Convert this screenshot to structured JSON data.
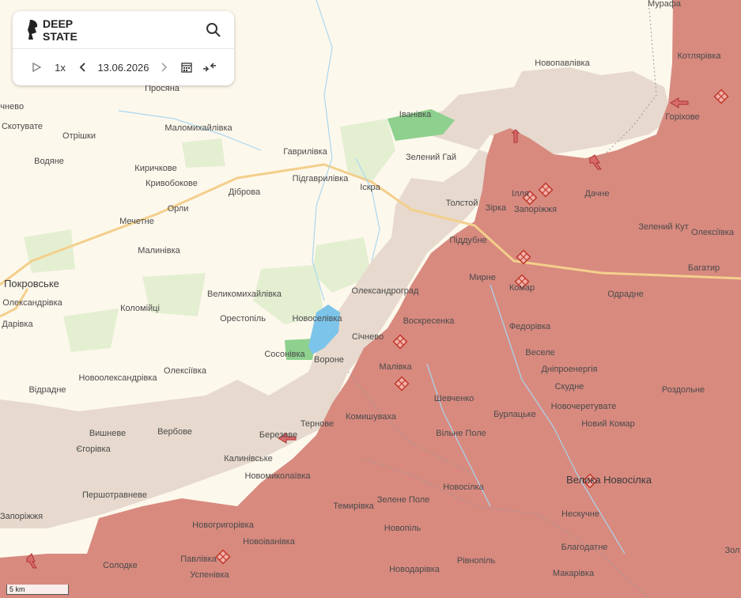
{
  "brand": {
    "line1": "DEEP",
    "line2": "STATE"
  },
  "controls": {
    "speed": "1x",
    "date": "13.06.2026"
  },
  "scale_label": "5 km",
  "colors": {
    "occupied": "#d88a7f",
    "contested": "#e6d8cc",
    "water": "#7cc4ea",
    "forest": "#8ed08e",
    "road": "#f7d99a",
    "background": "#fdf8ec"
  },
  "icons": [
    "logo-icon",
    "search-icon",
    "play-icon",
    "prev-icon",
    "next-icon",
    "calendar-icon",
    "collapse-icon",
    "battle-icon",
    "arrow-icon"
  ],
  "places": [
    {
      "name": "Просяна"
    },
    {
      "name": "Мурафа"
    },
    {
      "name": "Новопавлівка"
    },
    {
      "name": "Котлярівка"
    },
    {
      "name": "Горіхове"
    },
    {
      "name": "Маломихайлівка"
    },
    {
      "name": "Іванівка"
    },
    {
      "name": "Зелений Гай"
    },
    {
      "name": "Отрішки"
    },
    {
      "name": "Скотувате"
    },
    {
      "name": "Водяне"
    },
    {
      "name": "Гаврилівка"
    },
    {
      "name": "Киричкове"
    },
    {
      "name": "Кривобокове"
    },
    {
      "name": "Підгаврилівка"
    },
    {
      "name": "Діброва"
    },
    {
      "name": "Іскра"
    },
    {
      "name": "Орли"
    },
    {
      "name": "Мечетне"
    },
    {
      "name": "Толстой"
    },
    {
      "name": "Зірка"
    },
    {
      "name": "Запоріжжя"
    },
    {
      "name": "Дачне"
    },
    {
      "name": "Зелений Кут"
    },
    {
      "name": "Олексіївка"
    },
    {
      "name": "Малинівка"
    },
    {
      "name": "Піддубне"
    },
    {
      "name": "Покровське"
    },
    {
      "name": "Олександрівка"
    },
    {
      "name": "Мирне"
    },
    {
      "name": "Багатир"
    },
    {
      "name": "Коломійці"
    },
    {
      "name": "Великомихайлівка"
    },
    {
      "name": "Олександроград"
    },
    {
      "name": "Комар"
    },
    {
      "name": "Одрадне"
    },
    {
      "name": "Орестопіль"
    },
    {
      "name": "Новоселівка"
    },
    {
      "name": "Воскресенка"
    },
    {
      "name": "Федорівка"
    },
    {
      "name": "Січнево"
    },
    {
      "name": "Дарівка"
    },
    {
      "name": "Січнево"
    },
    {
      "name": "Сосонівка"
    },
    {
      "name": "Вороне"
    },
    {
      "name": "Веселе"
    },
    {
      "name": "Дніпроенергія"
    },
    {
      "name": "Малівка"
    },
    {
      "name": "Скудне"
    },
    {
      "name": "Новоолександрівка"
    },
    {
      "name": "Олексіївка"
    },
    {
      "name": "Роздольне"
    },
    {
      "name": "Відрадне"
    },
    {
      "name": "Шевченко"
    },
    {
      "name": "Бурлацьке"
    },
    {
      "name": "Новочеретувате"
    },
    {
      "name": "Комишуваха"
    },
    {
      "name": "Тернове"
    },
    {
      "name": "Вишневе"
    },
    {
      "name": "Вербове"
    },
    {
      "name": "Березове"
    },
    {
      "name": "Вільне Поле"
    },
    {
      "name": "Новий Комар"
    },
    {
      "name": "Єгорівка"
    },
    {
      "name": "Калинівське"
    },
    {
      "name": "Новомиколаївка"
    },
    {
      "name": "Велика Новосілка"
    },
    {
      "name": "Першотравневе"
    },
    {
      "name": "Новосілка"
    },
    {
      "name": "Темирівка"
    },
    {
      "name": "Зелене Поле"
    },
    {
      "name": "Нескучне"
    },
    {
      "name": "Запоріжжя"
    },
    {
      "name": "Новогригорівка"
    },
    {
      "name": "Новопіль"
    },
    {
      "name": "Новоіванівка"
    },
    {
      "name": "Благодатне"
    },
    {
      "name": "Солодке"
    },
    {
      "name": "Павлівка"
    },
    {
      "name": "Рівнопіль"
    },
    {
      "name": "Успенівка"
    },
    {
      "name": "Новодарівка"
    },
    {
      "name": "Макарівка"
    },
    {
      "name": "Зол"
    },
    {
      "name": "Ілля"
    }
  ]
}
